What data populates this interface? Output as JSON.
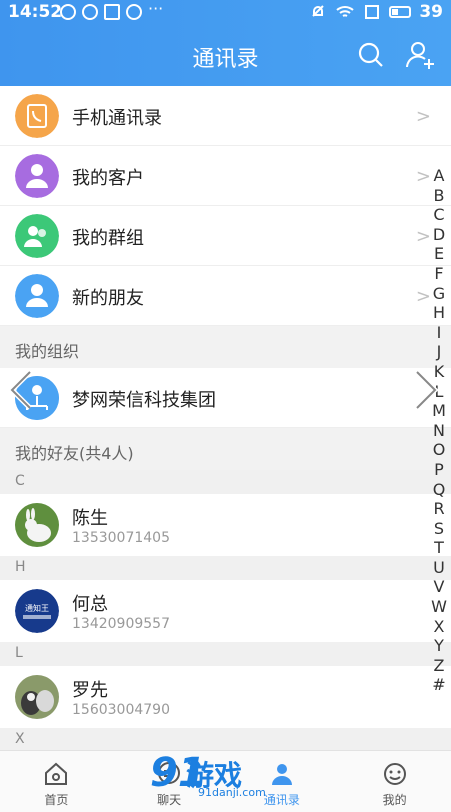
{
  "status_bar": {
    "time": "14:52",
    "battery": "39"
  },
  "header": {
    "title": "通讯录",
    "search_icon": "search-icon",
    "add_icon": "add-user-icon"
  },
  "menu": [
    {
      "label": "手机通讯录",
      "icon": "phone-book-icon",
      "color": "#f5a54a"
    },
    {
      "label": "我的客户",
      "icon": "customer-icon",
      "color": "#a76ce0"
    },
    {
      "label": "我的群组",
      "icon": "group-icon",
      "color": "#3cc878"
    },
    {
      "label": "新的朋友",
      "icon": "new-friend-icon",
      "color": "#4aa3f3"
    }
  ],
  "org_section": {
    "title": "我的组织",
    "org_name": "梦网荣信科技集团"
  },
  "friends_section": {
    "title": "我的好友(共4人)"
  },
  "contacts": [
    {
      "letter": "C",
      "name": "陈生",
      "phone": "13530071405"
    },
    {
      "letter": "H",
      "name": "何总",
      "phone": "13420909557"
    },
    {
      "letter": "L",
      "name": "罗先",
      "phone": "15603004790"
    },
    {
      "letter": "X"
    }
  ],
  "alpha_index": [
    "A",
    "B",
    "C",
    "D",
    "E",
    "F",
    "G",
    "H",
    "I",
    "J",
    "K",
    "L",
    "M",
    "N",
    "O",
    "P",
    "Q",
    "R",
    "S",
    "T",
    "U",
    "V",
    "W",
    "X",
    "Y",
    "Z",
    "#"
  ],
  "tabs": [
    {
      "label": "首页",
      "icon": "home-icon"
    },
    {
      "label": "聊天",
      "icon": "chat-icon"
    },
    {
      "label": "通讯录",
      "icon": "contacts-icon",
      "active": true
    },
    {
      "label": "我的",
      "icon": "me-icon"
    }
  ],
  "watermark": {
    "number": "91",
    "brand": "游戏",
    "url": "91danji.com"
  },
  "colors": {
    "primary": "#3f95ee"
  }
}
